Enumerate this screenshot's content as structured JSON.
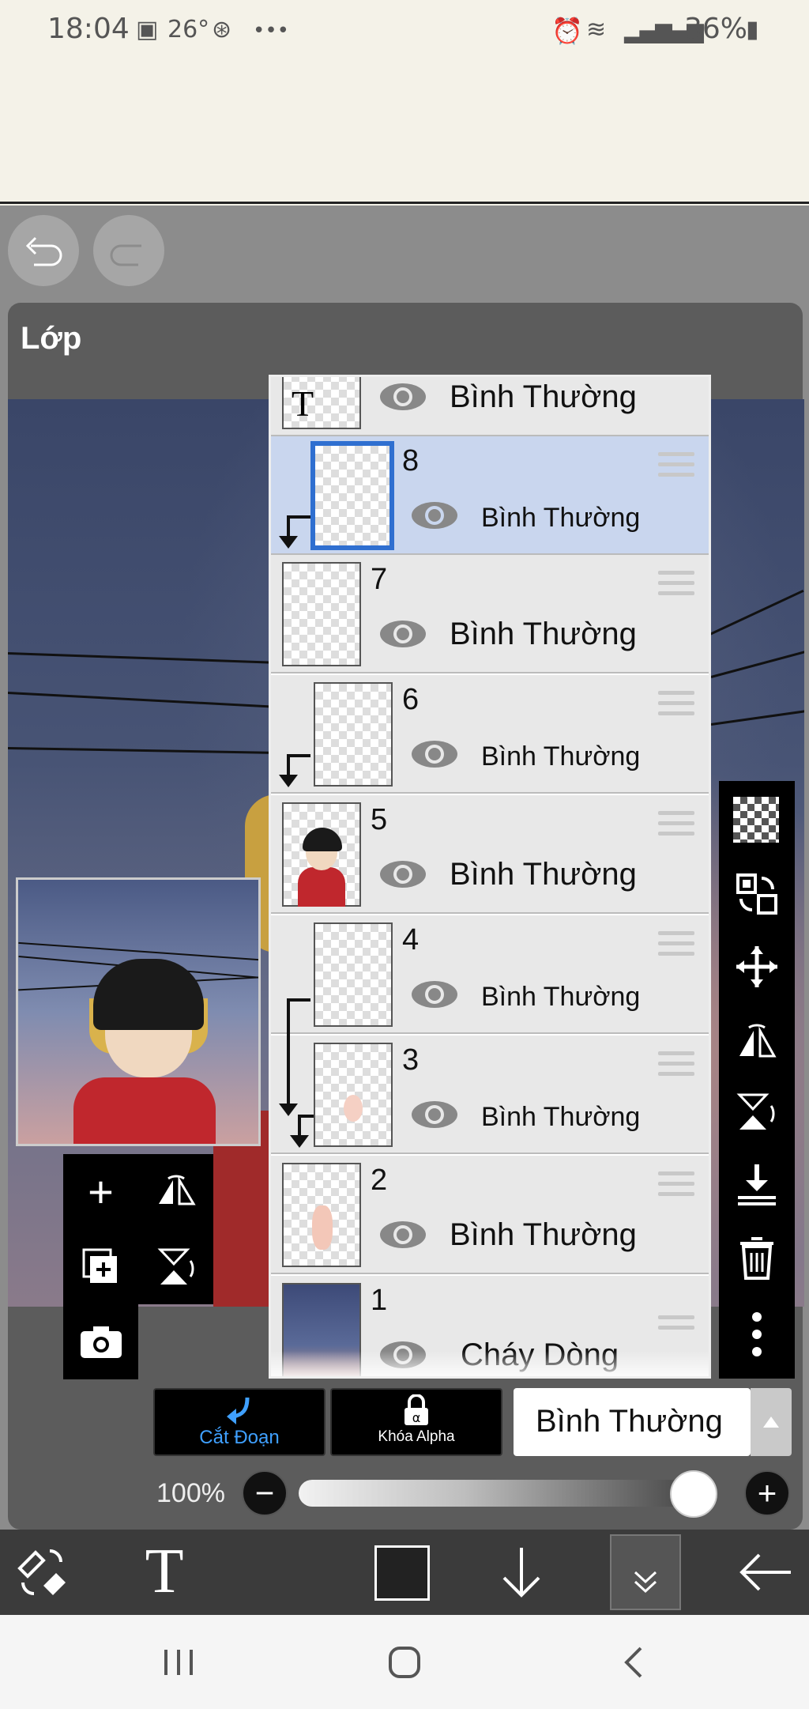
{
  "status_bar": {
    "time": "18:04",
    "temperature": "26°",
    "more": "•••",
    "battery": "36%"
  },
  "panel": {
    "title": "Lớp"
  },
  "layers": [
    {
      "id": "text",
      "number": "",
      "thumb_label": "T",
      "blend": "Bình Thường",
      "selected": false
    },
    {
      "id": "8",
      "number": "8",
      "blend": "Bình Thường",
      "selected": true,
      "clipped": true
    },
    {
      "id": "7",
      "number": "7",
      "blend": "Bình Thường",
      "selected": false
    },
    {
      "id": "6",
      "number": "6",
      "blend": "Bình Thường",
      "selected": false,
      "clipped": true
    },
    {
      "id": "5",
      "number": "5",
      "blend": "Bình Thường",
      "selected": false
    },
    {
      "id": "4",
      "number": "4",
      "blend": "Bình Thường",
      "selected": false,
      "clipped": true
    },
    {
      "id": "3",
      "number": "3",
      "blend": "Bình Thường",
      "selected": false,
      "clipped": true
    },
    {
      "id": "2",
      "number": "2",
      "blend": "Bình Thường",
      "selected": false
    },
    {
      "id": "1",
      "number": "1",
      "blend": "Cháy Dòng",
      "selected": false
    }
  ],
  "controls": {
    "clipping_label": "Cắt Đoạn",
    "alpha_lock_label": "Khóa Alpha",
    "blend_mode": "Bình Thường",
    "opacity_label": "100%",
    "opacity_value": 1.0,
    "minus": "−",
    "plus": "+"
  },
  "left_tools": {
    "add": "+",
    "photo": "📷"
  },
  "colors": {
    "accent_blue": "#2f6fd0",
    "selected_row": "#c9d6ee",
    "clip_label_blue": "#3fa0ff",
    "current_color": "#222222"
  }
}
